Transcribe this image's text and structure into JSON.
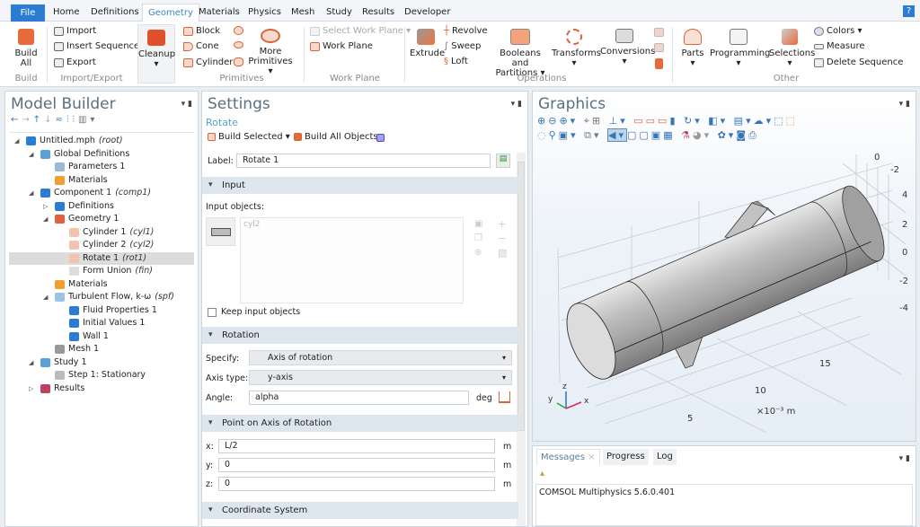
{
  "menu": {
    "tabs": [
      "File",
      "Home",
      "Definitions",
      "Geometry",
      "Materials",
      "Physics",
      "Mesh",
      "Study",
      "Results",
      "Developer"
    ],
    "active": "Geometry",
    "help_label": "?"
  },
  "ribbon": {
    "build": {
      "build_all": "Build All",
      "group": "Build"
    },
    "import_export": {
      "import": "Import",
      "insert_sequence": "Insert Sequence",
      "export": "Export",
      "group": "Import/Export"
    },
    "cleanup": {
      "label": "Cleanup",
      "arrow": "▾"
    },
    "primitives": {
      "block": "Block",
      "cone": "Cone",
      "cylinder": "Cylinder",
      "more": "More",
      "more2": "Primitives ▾",
      "group": "Primitives"
    },
    "work_plane": {
      "select": "Select Work Plane ▾",
      "work_plane": "Work Plane",
      "group": "Work Plane"
    },
    "operations": {
      "extrude": "Extrude",
      "revolve": "Revolve",
      "sweep": "Sweep",
      "loft": "Loft",
      "booleans": "Booleans and",
      "booleans2": "Partitions ▾",
      "transforms": "Transforms",
      "conversions": "Conversions",
      "group": "Operations"
    },
    "other": {
      "parts": "Parts",
      "programming": "Programming",
      "selections": "Selections",
      "colors": "Colors ▾",
      "measure": "Measure",
      "delete_sequence": "Delete Sequence",
      "group": "Other"
    }
  },
  "model_builder": {
    "title": "Model Builder",
    "tree": [
      {
        "label": "Untitled.mph",
        "tag": "(root)",
        "level": 0,
        "expand": "open",
        "icon": "file-icon",
        "color": "#2b7cd3"
      },
      {
        "label": "Global Definitions",
        "tag": "",
        "level": 1,
        "expand": "open",
        "icon": "globe-icon",
        "color": "#5aa0d8"
      },
      {
        "label": "Parameters 1",
        "tag": "",
        "level": 2,
        "expand": "",
        "icon": "parameters-icon",
        "color": "#9bb8d6"
      },
      {
        "label": "Materials",
        "tag": "",
        "level": 2,
        "expand": "",
        "icon": "materials-icon",
        "color": "#f0a030"
      },
      {
        "label": "Component 1",
        "tag": "(comp1)",
        "level": 1,
        "expand": "open",
        "icon": "component-icon",
        "color": "#2b7cd3"
      },
      {
        "label": "Definitions",
        "tag": "",
        "level": 2,
        "expand": "closed",
        "icon": "definitions-icon",
        "color": "#2b7cd3"
      },
      {
        "label": "Geometry 1",
        "tag": "",
        "level": 2,
        "expand": "open",
        "icon": "geometry-icon",
        "color": "#e06040"
      },
      {
        "label": "Cylinder 1",
        "tag": "(cyl1)",
        "level": 3,
        "expand": "",
        "icon": "cylinder-icon",
        "color": "#f2c4b0"
      },
      {
        "label": "Cylinder 2",
        "tag": "(cyl2)",
        "level": 3,
        "expand": "",
        "icon": "cylinder-icon",
        "color": "#f2c4b0"
      },
      {
        "label": "Rotate 1",
        "tag": "(rot1)",
        "level": 3,
        "expand": "",
        "icon": "rotate-icon",
        "color": "#f2c4b0",
        "selected": true
      },
      {
        "label": "Form Union",
        "tag": "(fin)",
        "level": 3,
        "expand": "",
        "icon": "form-union-icon",
        "color": "#dddddd"
      },
      {
        "label": "Materials",
        "tag": "",
        "level": 2,
        "expand": "",
        "icon": "materials-icon",
        "color": "#f0a030"
      },
      {
        "label": "Turbulent Flow, k-ω",
        "tag": "(spf)",
        "level": 2,
        "expand": "open",
        "icon": "flow-icon",
        "color": "#9cc4e4"
      },
      {
        "label": "Fluid Properties 1",
        "tag": "",
        "level": 3,
        "expand": "",
        "icon": "physics-node-icon",
        "color": "#2b7cd3"
      },
      {
        "label": "Initial Values 1",
        "tag": "",
        "level": 3,
        "expand": "",
        "icon": "physics-node-icon",
        "color": "#2b7cd3"
      },
      {
        "label": "Wall 1",
        "tag": "",
        "level": 3,
        "expand": "",
        "icon": "physics-node-icon",
        "color": "#2b7cd3"
      },
      {
        "label": "Mesh 1",
        "tag": "",
        "level": 2,
        "expand": "",
        "icon": "mesh-icon",
        "color": "#999999"
      },
      {
        "label": "Study 1",
        "tag": "",
        "level": 1,
        "expand": "open",
        "icon": "study-icon",
        "color": "#5aa0d8"
      },
      {
        "label": "Step 1: Stationary",
        "tag": "",
        "level": 2,
        "expand": "",
        "icon": "step-icon",
        "color": "#bbbbbb"
      },
      {
        "label": "Results",
        "tag": "",
        "level": 1,
        "expand": "closed",
        "icon": "results-icon",
        "color": "#c04060"
      }
    ]
  },
  "settings": {
    "title": "Settings",
    "subtitle": "Rotate",
    "build_selected": "Build Selected ▾",
    "build_all_objects": "Build All Objects",
    "label_label": "Label:",
    "label_value": "Rotate 1",
    "input_section": "Input",
    "input_objects_label": "Input objects:",
    "input_objects": [
      "cyl2"
    ],
    "keep_input": "Keep input objects",
    "keep_input_checked": false,
    "rotation_section": "Rotation",
    "specify_label": "Specify:",
    "specify_value": "Axis of rotation",
    "axis_type_label": "Axis type:",
    "axis_type_value": "y-axis",
    "angle_label": "Angle:",
    "angle_value": "alpha",
    "angle_unit": "deg",
    "point_section": "Point on Axis of Rotation",
    "point": [
      {
        "label": "x:",
        "value": "L/2",
        "unit": "m"
      },
      {
        "label": "y:",
        "value": "0",
        "unit": "m"
      },
      {
        "label": "z:",
        "value": "0",
        "unit": "m"
      }
    ],
    "coord_section": "Coordinate System"
  },
  "graphics": {
    "title": "Graphics",
    "ticks_top": [
      "0",
      "-2"
    ],
    "ticks_right": [
      "4",
      "2",
      "0",
      "-2",
      "-4"
    ],
    "ticks_bottom": [
      "15",
      "10",
      "5"
    ],
    "unit_label": "×10⁻³ m",
    "axes": {
      "x": "x",
      "y": "y",
      "z": "z"
    },
    "colors": {
      "x": "#e0205a",
      "y": "#30a040",
      "z": "#3070c0"
    }
  },
  "messages": {
    "tabs": [
      "Messages",
      "Progress",
      "Log"
    ],
    "active": "Messages",
    "text": "COMSOL Multiphysics 5.6.0.401"
  }
}
